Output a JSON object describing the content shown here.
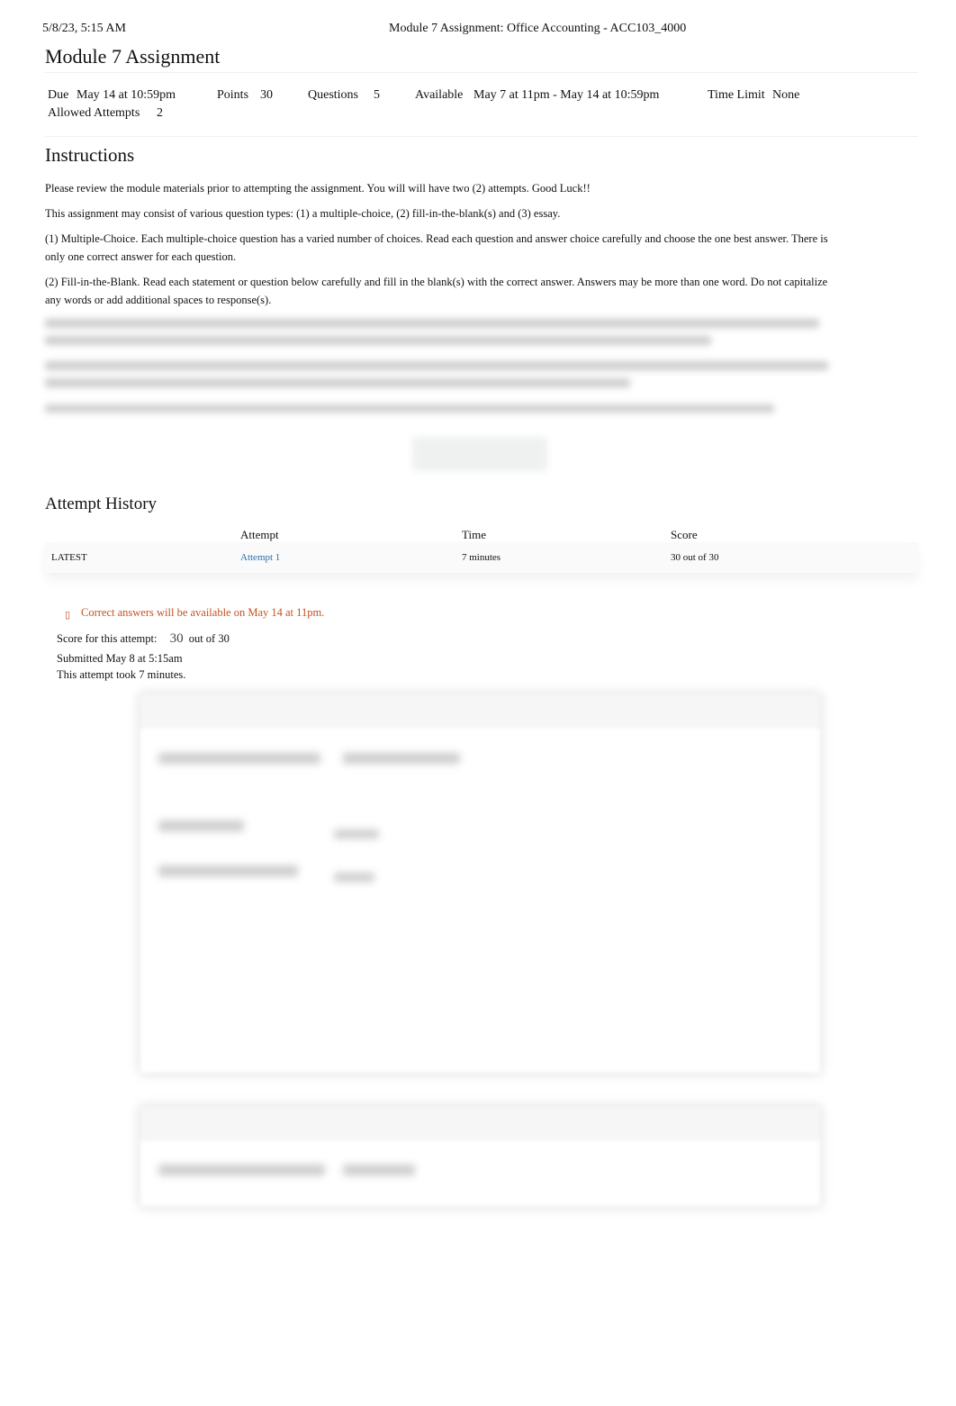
{
  "header": {
    "timestamp": "5/8/23, 5:15 AM",
    "page_title": "Module 7 Assignment: Office Accounting - ACC103_4000"
  },
  "title": "Module 7 Assignment",
  "meta": {
    "due_label": "Due",
    "due": "May 14 at 10:59pm",
    "points_label": "Points",
    "points": "30",
    "questions_label": "Questions",
    "questions": "5",
    "available_label": "Available",
    "available": "May 7 at 11pm - May 14 at 10:59pm",
    "time_limit_label": "Time Limit",
    "time_limit": "None",
    "attempts_label": "Allowed Attempts",
    "attempts": "2"
  },
  "instructions": {
    "heading": "Instructions",
    "paragraphs": [
      "Please review the module materials prior to attempting the assignment. You will will have two (2) attempts. Good Luck!!",
      "This assignment may consist of various question types: (1) a multiple-choice, (2) fill-in-the-blank(s) and (3) essay.",
      "(1) Multiple-Choice. Each multiple-choice question has a varied number of choices. Read each question and answer choice carefully and choose the one best answer. There is only one correct answer for each question.",
      "(2) Fill-in-the-Blank. Read each statement or question below carefully and fill in the blank(s) with the correct answer. Answers may be more than one word. Do not capitalize any words or add additional spaces to response(s)."
    ]
  },
  "attempt_history": {
    "heading": "Attempt History",
    "columns": [
      "",
      "Attempt",
      "Time",
      "Score"
    ],
    "rows": [
      {
        "label": "LATEST",
        "attempt": "Attempt 1",
        "time": "7 minutes",
        "score": "30 out of 30"
      }
    ]
  },
  "result": {
    "notice": "Correct answers will be available on May 14 at 11pm.",
    "notice_color": "#c7511f",
    "score_label": "Score for this attempt:",
    "score": "30",
    "score_total": "out of 30",
    "submitted": "Submitted May 8 at 5:15am",
    "duration": "This attempt took 7 minutes."
  }
}
